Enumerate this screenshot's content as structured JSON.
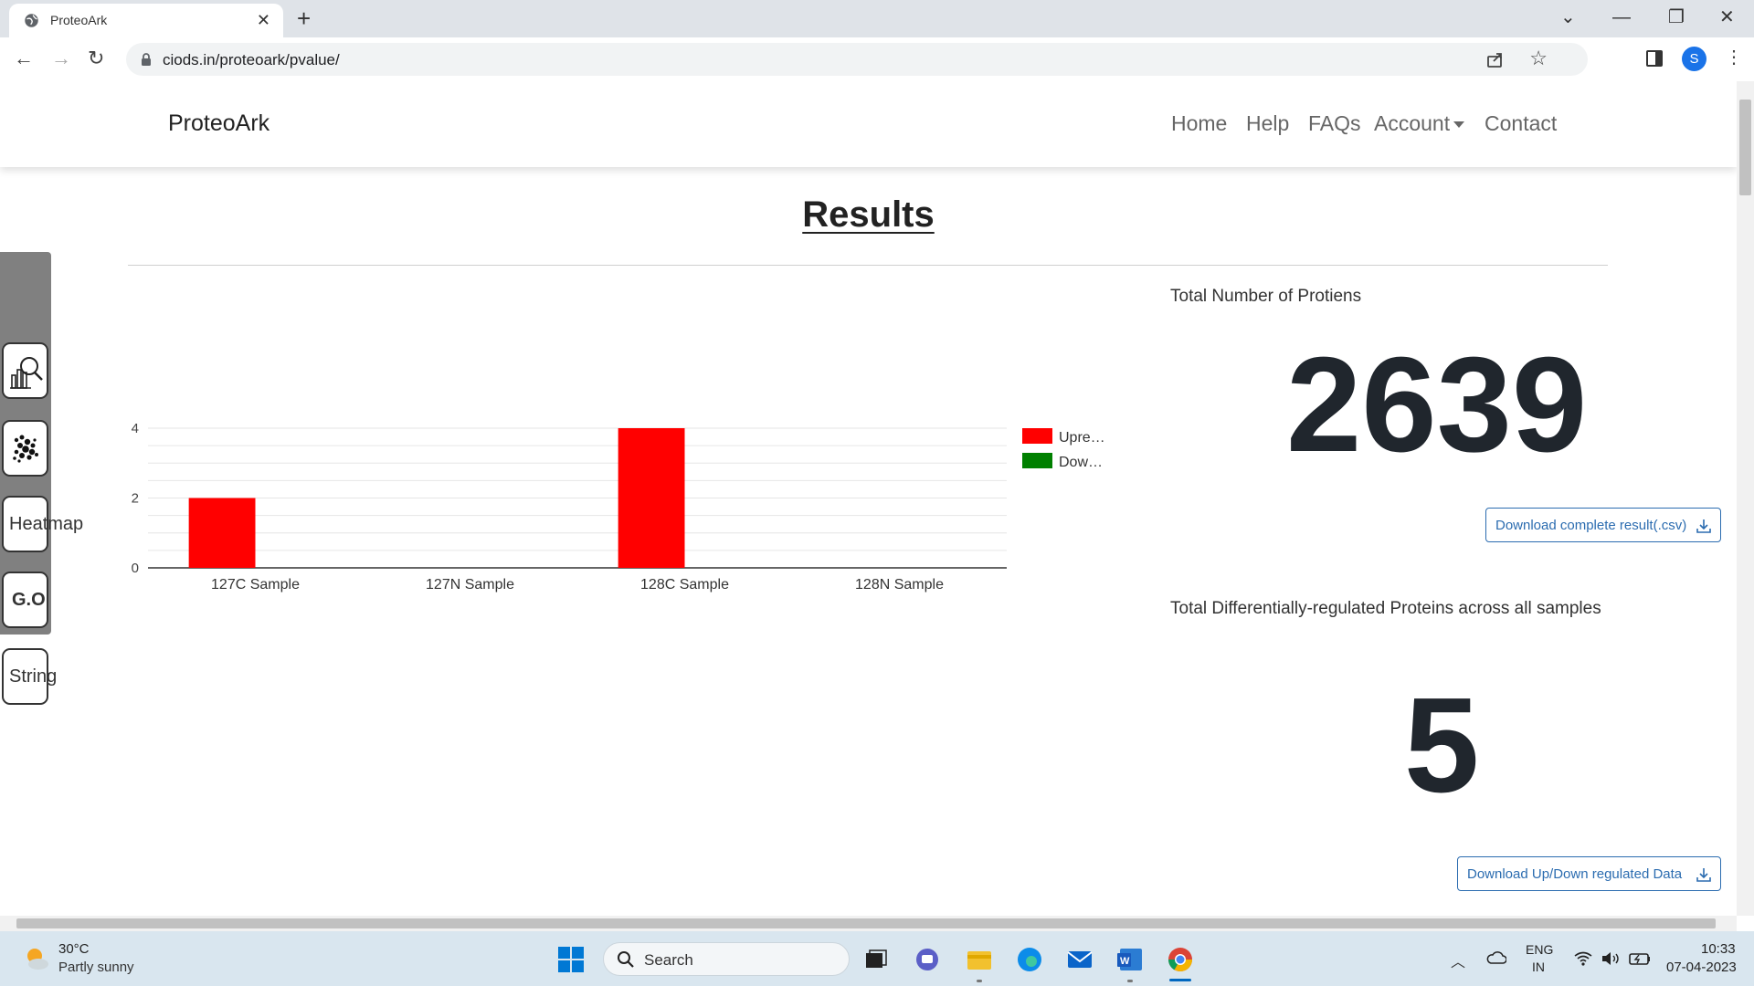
{
  "browser": {
    "tab_title": "ProteoArk",
    "url": "ciods.in/proteoark/pvalue/",
    "profile_initial": "S"
  },
  "navbar": {
    "brand": "ProteoArk",
    "links": [
      "Home",
      "Help",
      "FAQs",
      "Account",
      "Contact"
    ]
  },
  "page": {
    "title": "Results"
  },
  "toolrail": {
    "items": [
      {
        "label": "",
        "icon": "chart-search-icon"
      },
      {
        "label": "",
        "icon": "scatter-dots-icon"
      },
      {
        "label": "Heatmap",
        "icon": ""
      },
      {
        "label": "G.O",
        "icon": ""
      },
      {
        "label": "String",
        "icon": ""
      }
    ]
  },
  "chart_data": {
    "type": "bar",
    "categories": [
      "127C Sample",
      "127N Sample",
      "128C Sample",
      "128N Sample"
    ],
    "series": [
      {
        "name": "Upre…",
        "values": [
          2,
          0,
          4,
          0
        ],
        "color": "#ff0000"
      },
      {
        "name": "Dow…",
        "values": [
          0,
          0,
          0,
          0
        ],
        "color": "#008000"
      }
    ],
    "yticks": [
      0,
      2,
      4
    ],
    "ylim": [
      0,
      4
    ],
    "grid": true,
    "legend": "right"
  },
  "stats": {
    "total_label": "Total Number of Protiens",
    "total_value": "2639",
    "download_complete": "Download complete result(.csv)",
    "diff_label": "Total Differentially-regulated Proteins across all samples",
    "diff_value": "5",
    "download_updown": "Download Up/Down regulated Data"
  },
  "taskbar": {
    "weather_temp": "30°C",
    "weather_desc": "Partly sunny",
    "search_placeholder": "Search",
    "lang_line1": "ENG",
    "lang_line2": "IN",
    "time": "10:33",
    "date": "07-04-2023"
  }
}
